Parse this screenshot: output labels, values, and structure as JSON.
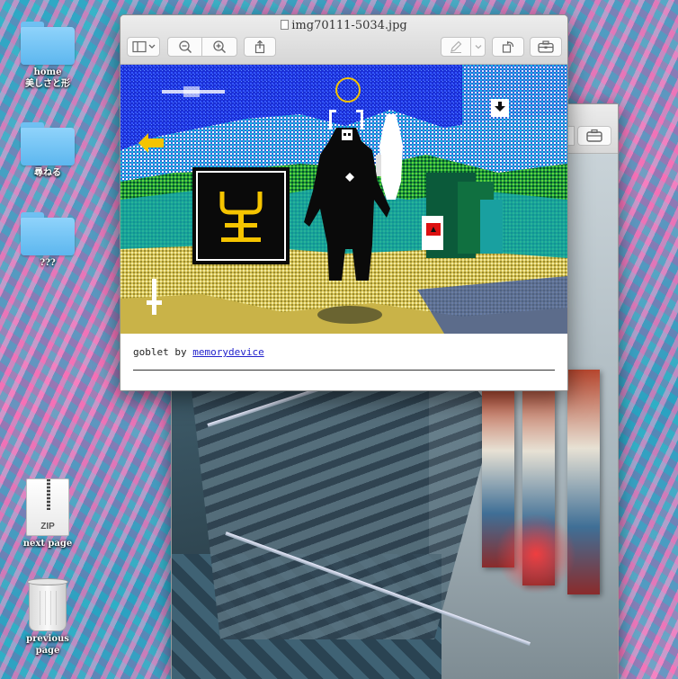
{
  "desktop": {
    "icons": [
      {
        "label": "home\n美しさと形",
        "type": "folder"
      },
      {
        "label": "尋ねる",
        "type": "folder"
      },
      {
        "label": "???",
        "type": "folder"
      },
      {
        "label": "next page",
        "type": "zip",
        "badge": "ZIP"
      },
      {
        "label": "previous page",
        "type": "trash"
      }
    ]
  },
  "preview_window": {
    "title": "img70111-5034.jpg",
    "toolbar": {
      "sidebar_icon": "sidebar-icon",
      "zoom_out_icon": "zoom-out-icon",
      "zoom_in_icon": "zoom-in-icon",
      "share_icon": "share-icon",
      "markup_icon": "pen-icon",
      "rotate_icon": "rotate-icon",
      "toolbox_icon": "toolbox-icon"
    },
    "caption": {
      "prefix": "goblet by ",
      "link_text": "memorydevice"
    }
  },
  "colors": {
    "accent_yellow": "#f5c400",
    "link": "#2222cc",
    "pixel_sky": "#1a2fd6"
  }
}
